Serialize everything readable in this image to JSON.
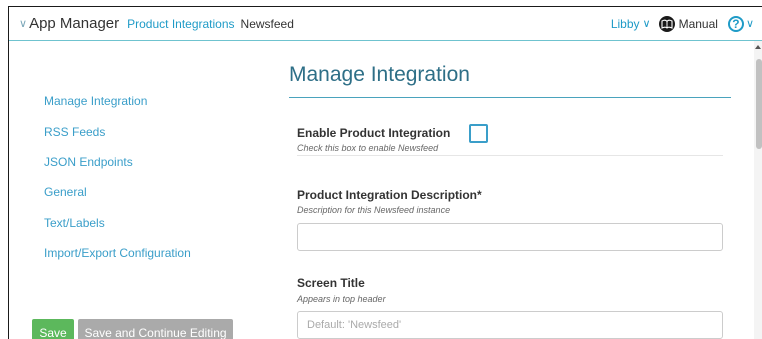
{
  "header": {
    "app_title": "App Manager",
    "breadcrumb_link": "Product Integrations",
    "breadcrumb_current": "Newsfeed",
    "user_name": "Libby",
    "manual_label": "Manual",
    "help_symbol": "?",
    "chevron_symbol": "∨",
    "accent_color": "#1f9bc7"
  },
  "sidebar": {
    "items": [
      {
        "label": "Manage Integration"
      },
      {
        "label": "RSS Feeds"
      },
      {
        "label": "JSON Endpoints"
      },
      {
        "label": "General"
      },
      {
        "label": "Text/Labels"
      },
      {
        "label": "Import/Export Configuration"
      }
    ],
    "save_label": "Save",
    "save_continue_label": "Save and Continue Editing"
  },
  "main": {
    "page_title": "Manage Integration",
    "enable": {
      "label": "Enable Product Integration",
      "hint": "Check this box to enable Newsfeed",
      "checked": false
    },
    "description": {
      "label": "Product Integration Description*",
      "hint": "Description for this Newsfeed instance",
      "value": ""
    },
    "screen_title": {
      "label": "Screen Title",
      "hint": "Appears in top header",
      "value": "",
      "placeholder": "Default: 'Newsfeed'"
    }
  },
  "icons": {
    "header_chevron": "chevron-down-icon",
    "manual": "manual-book-icon",
    "help": "help-circle-icon",
    "scroll_up": "scroll-up-arrow-icon"
  }
}
